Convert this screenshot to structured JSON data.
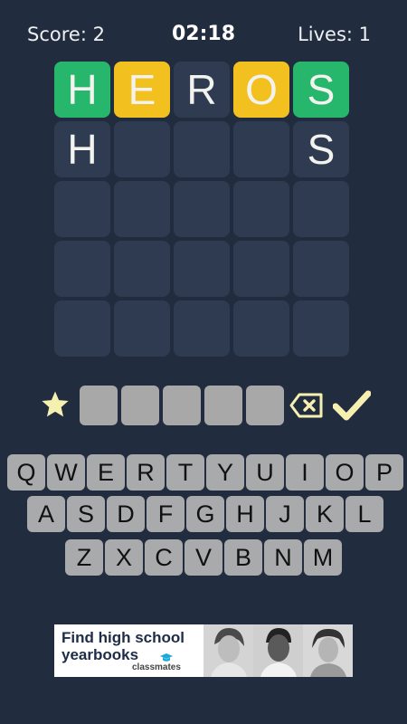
{
  "header": {
    "score": "Score: 2",
    "timer": "02:18",
    "lives": "Lives: 1"
  },
  "grid": {
    "rows": [
      [
        {
          "letter": "H",
          "state": "green"
        },
        {
          "letter": "E",
          "state": "yellow"
        },
        {
          "letter": "R",
          "state": "empty"
        },
        {
          "letter": "O",
          "state": "yellow"
        },
        {
          "letter": "S",
          "state": "green"
        }
      ],
      [
        {
          "letter": "H",
          "state": "empty"
        },
        {
          "letter": "",
          "state": "empty"
        },
        {
          "letter": "",
          "state": "empty"
        },
        {
          "letter": "",
          "state": "empty"
        },
        {
          "letter": "S",
          "state": "empty"
        }
      ],
      [
        {
          "letter": "",
          "state": "empty"
        },
        {
          "letter": "",
          "state": "empty"
        },
        {
          "letter": "",
          "state": "empty"
        },
        {
          "letter": "",
          "state": "empty"
        },
        {
          "letter": "",
          "state": "empty"
        }
      ],
      [
        {
          "letter": "",
          "state": "empty"
        },
        {
          "letter": "",
          "state": "empty"
        },
        {
          "letter": "",
          "state": "empty"
        },
        {
          "letter": "",
          "state": "empty"
        },
        {
          "letter": "",
          "state": "empty"
        }
      ],
      [
        {
          "letter": "",
          "state": "empty"
        },
        {
          "letter": "",
          "state": "empty"
        },
        {
          "letter": "",
          "state": "empty"
        },
        {
          "letter": "",
          "state": "empty"
        },
        {
          "letter": "",
          "state": "empty"
        }
      ]
    ]
  },
  "entry": {
    "hint_icon": "star-icon",
    "slots": [
      "",
      "",
      "",
      "",
      ""
    ],
    "backspace_icon": "backspace-icon",
    "submit_icon": "check-icon"
  },
  "keyboard": {
    "rows": [
      [
        "Q",
        "W",
        "E",
        "R",
        "T",
        "Y",
        "U",
        "I",
        "O",
        "P"
      ],
      [
        "A",
        "S",
        "D",
        "F",
        "G",
        "H",
        "J",
        "K",
        "L"
      ],
      [
        "Z",
        "X",
        "C",
        "V",
        "B",
        "N",
        "M"
      ]
    ]
  },
  "ad": {
    "line1": "Find high school",
    "line2": "yearbooks",
    "brand": "classmates"
  },
  "colors": {
    "background": "#222c3f",
    "tile_empty": "#2e3b50",
    "tile_correct": "#27b76c",
    "tile_present": "#f2c01f",
    "key": "#a9aaab",
    "icon_accent": "#f6f0b0"
  }
}
